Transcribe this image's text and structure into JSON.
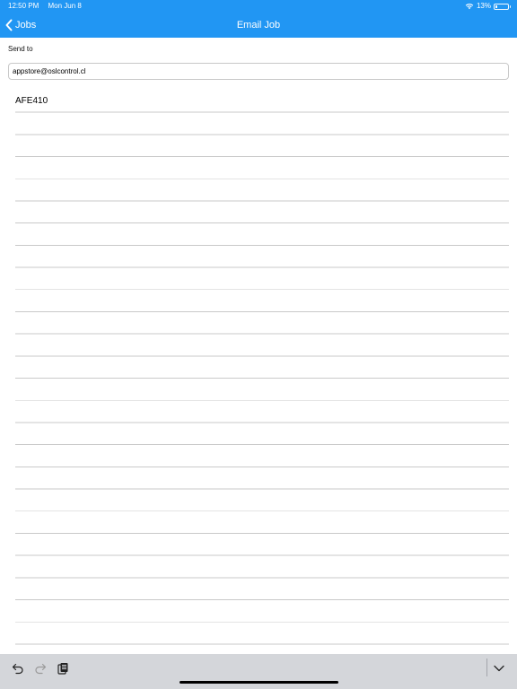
{
  "status_bar": {
    "time": "12:50 PM",
    "date": "Mon Jun 8",
    "battery_percent": "13%",
    "battery_level": 0.13,
    "icons": [
      "wifi-icon",
      "battery-icon"
    ]
  },
  "nav": {
    "back_label": "Jobs",
    "title": "Email Job",
    "icons": [
      "chevron-left-icon"
    ]
  },
  "form": {
    "send_to_label": "Send to",
    "send_to_value": "appstore@oslcontrol.cl",
    "body_text": "AFE410"
  },
  "toolbar": {
    "icons": [
      "undo-icon",
      "redo-icon",
      "paste-icon",
      "chevron-down-icon"
    ]
  },
  "colors": {
    "accent": "#2196f3",
    "toolbar_bg": "#d4d6da",
    "rule_line": "#c9c9c9"
  }
}
